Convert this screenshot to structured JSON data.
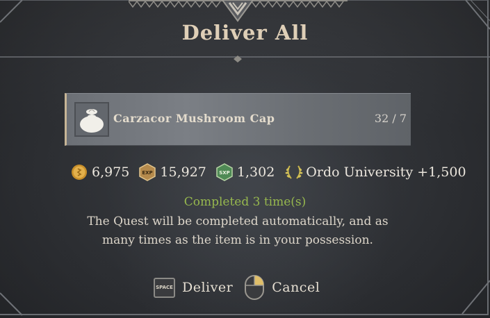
{
  "dialog": {
    "title": "Deliver All"
  },
  "item": {
    "name": "Carzacor Mushroom Cap",
    "count": "32 / 7",
    "icon": "mushroom-bag-icon"
  },
  "rewards": [
    {
      "icon": "gold-coin-icon",
      "value": "6,975"
    },
    {
      "icon": "exp-badge-icon",
      "value": "15,927"
    },
    {
      "icon": "sxp-badge-icon",
      "value": "1,302"
    },
    {
      "icon": "laurel-icon",
      "value": "Ordo University +1,500"
    }
  ],
  "status": {
    "completed_text": "Completed 3 time(s)",
    "info_line1": "The Quest will be completed automatically, and as",
    "info_line2": "many times as the item is in your possession."
  },
  "actions": {
    "deliver_key": "SPACE",
    "deliver_label": "Deliver",
    "cancel_label": "Cancel",
    "cancel_icon": "mouse-right-click-icon"
  },
  "colors": {
    "title": "#dfcfb7",
    "completed": "#97b84e",
    "gold": "#d9a53a",
    "sxp": "#4f8a55"
  }
}
